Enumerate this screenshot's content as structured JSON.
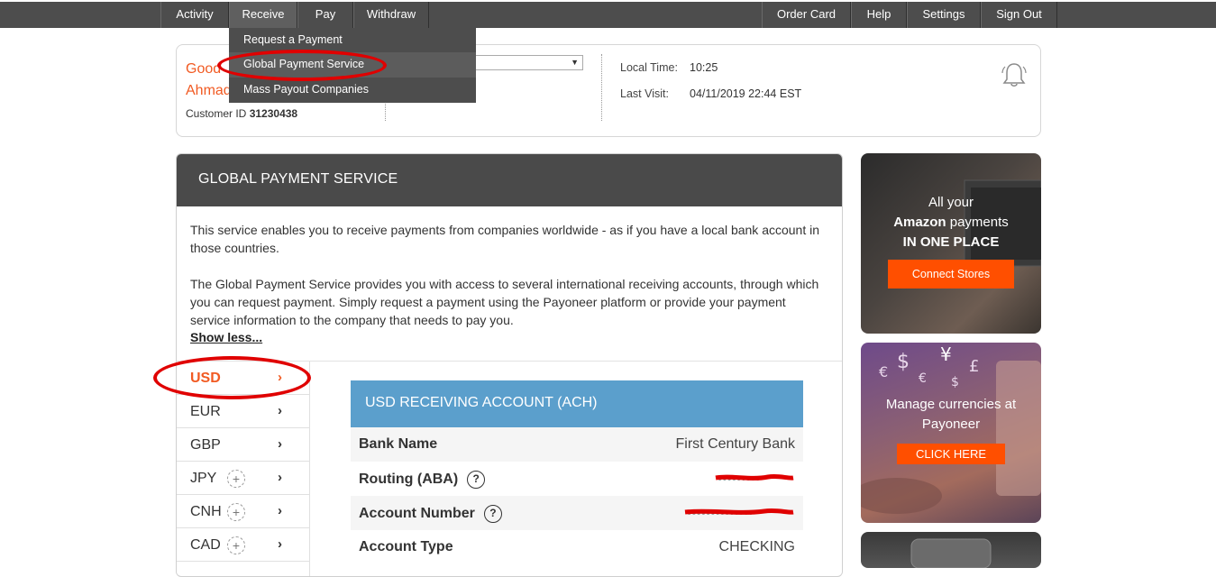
{
  "nav": {
    "left": [
      {
        "label": "Activity"
      },
      {
        "label": "Receive"
      },
      {
        "label": "Pay"
      },
      {
        "label": "Withdraw"
      }
    ],
    "right": [
      {
        "label": "Order Card"
      },
      {
        "label": "Help"
      },
      {
        "label": "Settings"
      },
      {
        "label": "Sign Out"
      }
    ],
    "active": "Receive"
  },
  "receive_menu": {
    "items": [
      {
        "label": "Request a Payment"
      },
      {
        "label": "Global Payment Service"
      },
      {
        "label": "Mass Payout Companies"
      }
    ],
    "highlighted": "Global Payment Service"
  },
  "header": {
    "greeting_line1": "Good",
    "greeting_line2": "Ahmad",
    "customer_id_label": "Customer ID",
    "customer_id": "31230438",
    "local_time_label": "Local Time:",
    "local_time": "10:25",
    "last_visit_label": "Last Visit:",
    "last_visit": "04/11/2019 22:44 EST"
  },
  "gps": {
    "title": "GLOBAL PAYMENT SERVICE",
    "para1": "This service enables you to receive payments from companies worldwide - as if you have a local bank account in those countries.",
    "para2": "The Global Payment Service provides you with access to several international receiving accounts, through which you can request payment. Simply request a payment using the Payoneer platform or provide your payment service information to the company that needs to pay you.",
    "show_less": "Show less...",
    "currencies": [
      {
        "code": "USD",
        "active": true,
        "addable": false
      },
      {
        "code": "EUR",
        "active": false,
        "addable": false
      },
      {
        "code": "GBP",
        "active": false,
        "addable": false
      },
      {
        "code": "JPY",
        "active": false,
        "addable": true
      },
      {
        "code": "CNH",
        "active": false,
        "addable": true
      },
      {
        "code": "CAD",
        "active": false,
        "addable": true
      }
    ]
  },
  "account": {
    "title": "USD RECEIVING ACCOUNT (ACH)",
    "rows": [
      {
        "label": "Bank Name",
        "value": "First Century Bank"
      },
      {
        "label": "Routing (ABA)",
        "value": ""
      },
      {
        "label": "Account Number",
        "value": ""
      },
      {
        "label": "Account Type",
        "value": "CHECKING"
      }
    ]
  },
  "ads": {
    "ad1_line1": "All your",
    "ad1_bold": "Amazon",
    "ad1_line2_rest": " payments",
    "ad1_line3": "IN ONE PLACE",
    "ad1_button": "Connect Stores",
    "ad2_line1": "Manage currencies at",
    "ad2_line2": "Payoneer",
    "ad2_button": "CLICK HERE"
  },
  "colors": {
    "nav_bg": "#4d4d4d",
    "accent": "#f15a22",
    "account_header": "#5b9fcc",
    "cta": "#ff4f00",
    "annotation": "#e00000"
  }
}
